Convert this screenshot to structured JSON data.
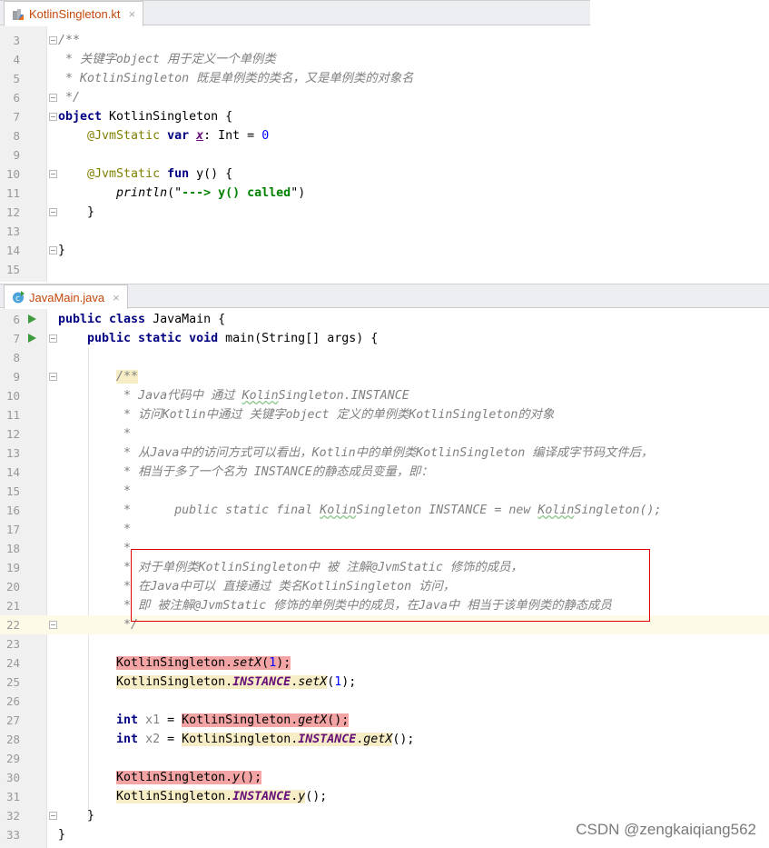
{
  "top": {
    "tab": {
      "label": "KotlinSingleton.kt",
      "icon": "kotlin-file-icon",
      "close": "×"
    },
    "lines": [
      {
        "n": "3",
        "fold": true,
        "tk": [
          {
            "t": "/**",
            "k": "cm"
          }
        ]
      },
      {
        "n": "4",
        "tk": [
          {
            "t": " * 关键字object 用于定义一个单例类",
            "k": "cm"
          }
        ]
      },
      {
        "n": "5",
        "tk": [
          {
            "t": " * KotlinSingleton 既是单例类的类名，又是单例类的对象名",
            "k": "cm"
          }
        ]
      },
      {
        "n": "6",
        "fold": true,
        "tk": [
          {
            "t": " */",
            "k": "cm"
          }
        ]
      },
      {
        "n": "7",
        "fold": true,
        "tk": [
          {
            "t": "object",
            "k": "kw"
          },
          {
            "t": " KotlinSingleton {",
            "k": ""
          }
        ]
      },
      {
        "n": "8",
        "tk": [
          {
            "t": "    @JvmStatic",
            "k": "ann"
          },
          {
            "t": " var",
            "k": "kw"
          },
          {
            "t": " ",
            "k": ""
          },
          {
            "t": "x",
            "k": "fld ul"
          },
          {
            "t": ": Int = ",
            "k": ""
          },
          {
            "t": "0",
            "k": "num"
          }
        ]
      },
      {
        "n": "9",
        "tk": []
      },
      {
        "n": "10",
        "fold": true,
        "tk": [
          {
            "t": "    @JvmStatic",
            "k": "ann"
          },
          {
            "t": " fun",
            "k": "kw"
          },
          {
            "t": " y() {",
            "k": ""
          }
        ]
      },
      {
        "n": "11",
        "tk": [
          {
            "t": "        ",
            "k": ""
          },
          {
            "t": "println",
            "k": "it"
          },
          {
            "t": "(\"",
            "k": ""
          },
          {
            "t": "---> y() called",
            "k": "str"
          },
          {
            "t": "\")",
            "k": ""
          }
        ]
      },
      {
        "n": "12",
        "fold": true,
        "tk": [
          {
            "t": "    }",
            "k": ""
          }
        ]
      },
      {
        "n": "13",
        "tk": []
      },
      {
        "n": "14",
        "fold": true,
        "tk": [
          {
            "t": "}",
            "k": ""
          }
        ]
      },
      {
        "n": "15",
        "tk": []
      }
    ]
  },
  "bottom": {
    "tab": {
      "label": "JavaMain.java",
      "icon": "java-class-icon",
      "close": "×"
    },
    "lines": [
      {
        "n": "6",
        "run": true,
        "tk": [
          {
            "t": "public class",
            "k": "kw"
          },
          {
            "t": " JavaMain {",
            "k": ""
          }
        ]
      },
      {
        "n": "7",
        "run": true,
        "fold": true,
        "tk": [
          {
            "t": "    public static void",
            "k": "kw"
          },
          {
            "t": " main(String[] args) {",
            "k": ""
          }
        ]
      },
      {
        "n": "8",
        "tk": []
      },
      {
        "n": "9",
        "fold": true,
        "tk": [
          {
            "t": "        ",
            "k": ""
          },
          {
            "t": "/**",
            "k": "cm h-yel"
          }
        ]
      },
      {
        "n": "10",
        "tk": [
          {
            "t": "         * Java代码中 通过 ",
            "k": "cm"
          },
          {
            "t": "Kolin",
            "k": "cm wav"
          },
          {
            "t": "Singleton.INSTANCE",
            "k": "cm"
          }
        ]
      },
      {
        "n": "11",
        "tk": [
          {
            "t": "         * 访问Kotlin中通过 关键字object 定义的单例类KotlinSingleton的对象",
            "k": "cm"
          }
        ]
      },
      {
        "n": "12",
        "tk": [
          {
            "t": "         *",
            "k": "cm"
          }
        ]
      },
      {
        "n": "13",
        "tk": [
          {
            "t": "         * 从Java中的访问方式可以看出，Kotlin中的单例类KotlinSingleton 编译成字节码文件后，",
            "k": "cm"
          }
        ]
      },
      {
        "n": "14",
        "tk": [
          {
            "t": "         * 相当于多了一个名为 INSTANCE的静态成员变量，即：",
            "k": "cm"
          }
        ]
      },
      {
        "n": "15",
        "tk": [
          {
            "t": "         *",
            "k": "cm"
          }
        ]
      },
      {
        "n": "16",
        "tk": [
          {
            "t": "         *      public static final ",
            "k": "cm"
          },
          {
            "t": "Kolin",
            "k": "cm wav"
          },
          {
            "t": "Singleton INSTANCE = new ",
            "k": "cm"
          },
          {
            "t": "Kolin",
            "k": "cm wav"
          },
          {
            "t": "Singleton();",
            "k": "cm"
          }
        ]
      },
      {
        "n": "17",
        "tk": [
          {
            "t": "         *",
            "k": "cm"
          }
        ]
      },
      {
        "n": "18",
        "tk": [
          {
            "t": "         *",
            "k": "cm"
          }
        ]
      },
      {
        "n": "19",
        "tk": [
          {
            "t": "         * 对于单例类KotlinSingleton中 被 注解@JvmStatic 修饰的成员，",
            "k": "cm"
          }
        ]
      },
      {
        "n": "20",
        "tk": [
          {
            "t": "         * 在Java中可以 直接通过 类名KotlinSingleton 访问，",
            "k": "cm"
          }
        ]
      },
      {
        "n": "21",
        "tk": [
          {
            "t": "         * 即 被注解@JvmStatic 修饰的单例类中的成员，在Java中 相当于该单例类的静态成员",
            "k": "cm"
          }
        ]
      },
      {
        "n": "22",
        "cur": true,
        "fold": true,
        "tk": [
          {
            "t": "         */",
            "k": "cm"
          }
        ]
      },
      {
        "n": "23",
        "tk": []
      },
      {
        "n": "24",
        "tk": [
          {
            "t": "        ",
            "k": ""
          },
          {
            "t": "KotlinSingleton.",
            "k": "h-red"
          },
          {
            "t": "setX",
            "k": "it h-red"
          },
          {
            "t": "(",
            "k": "h-red"
          },
          {
            "t": "1",
            "k": "num h-red"
          },
          {
            "t": ");",
            "k": "h-red"
          }
        ]
      },
      {
        "n": "25",
        "tk": [
          {
            "t": "        ",
            "k": ""
          },
          {
            "t": "KotlinSingleton.",
            "k": "h-yel"
          },
          {
            "t": "INSTANCE",
            "k": "fld h-yel"
          },
          {
            "t": ".",
            "k": "h-yel"
          },
          {
            "t": "setX",
            "k": "it h-yel"
          },
          {
            "t": "(",
            "k": ""
          },
          {
            "t": "1",
            "k": "num"
          },
          {
            "t": ");",
            "k": ""
          }
        ]
      },
      {
        "n": "26",
        "tk": []
      },
      {
        "n": "27",
        "tk": [
          {
            "t": "        int",
            "k": "kw"
          },
          {
            "t": " x1",
            "k": "var"
          },
          {
            "t": " = ",
            "k": ""
          },
          {
            "t": "KotlinSingleton.",
            "k": "h-red"
          },
          {
            "t": "getX",
            "k": "it h-red"
          },
          {
            "t": "();",
            "k": "h-red"
          }
        ]
      },
      {
        "n": "28",
        "tk": [
          {
            "t": "        int",
            "k": "kw"
          },
          {
            "t": " x2",
            "k": "var"
          },
          {
            "t": " = ",
            "k": ""
          },
          {
            "t": "KotlinSingleton.",
            "k": "h-yel"
          },
          {
            "t": "INSTANCE",
            "k": "fld h-yel"
          },
          {
            "t": ".",
            "k": "h-yel"
          },
          {
            "t": "getX",
            "k": "it h-yel"
          },
          {
            "t": "();",
            "k": ""
          }
        ]
      },
      {
        "n": "29",
        "tk": []
      },
      {
        "n": "30",
        "tk": [
          {
            "t": "        ",
            "k": ""
          },
          {
            "t": "KotlinSingleton.",
            "k": "h-red"
          },
          {
            "t": "y",
            "k": "it h-red"
          },
          {
            "t": "();",
            "k": "h-red"
          }
        ]
      },
      {
        "n": "31",
        "tk": [
          {
            "t": "        ",
            "k": ""
          },
          {
            "t": "KotlinSingleton.",
            "k": "h-yel"
          },
          {
            "t": "INSTANCE",
            "k": "fld h-yel"
          },
          {
            "t": ".",
            "k": "h-yel"
          },
          {
            "t": "y",
            "k": "it h-yel"
          },
          {
            "t": "();",
            "k": ""
          }
        ]
      },
      {
        "n": "32",
        "fold": true,
        "tk": [
          {
            "t": "    }",
            "k": ""
          }
        ]
      },
      {
        "n": "33",
        "tk": [
          {
            "t": "}",
            "k": ""
          }
        ]
      }
    ]
  },
  "watermark": "CSDN @zengkaiqiang562",
  "colors": {
    "keyword": "#000080",
    "comment": "#808080",
    "string": "#008000",
    "number": "#0000ff",
    "annotation": "#808000",
    "static_field": "#660e7a",
    "error_highlight": "#f3a4a4",
    "usage_highlight": "#f6edc6",
    "annotation_box": "#e00000"
  }
}
